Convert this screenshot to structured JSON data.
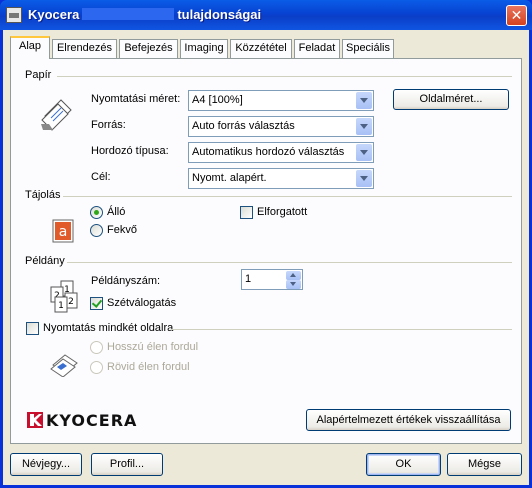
{
  "window": {
    "title_prefix": "Kyocera",
    "title_suffix": "tulajdonságai",
    "close_glyph": "✕"
  },
  "tabs": [
    {
      "label": "Alap",
      "active": true
    },
    {
      "label": "Elrendezés"
    },
    {
      "label": "Befejezés"
    },
    {
      "label": "Imaging"
    },
    {
      "label": "Közzététel"
    },
    {
      "label": "Feladat"
    },
    {
      "label": "Speciális"
    }
  ],
  "paper": {
    "group_label": "Papír",
    "print_size_label": "Nyomtatási méret:",
    "print_size_value": "A4  [100%]",
    "page_size_button": "Oldalméret...",
    "source_label": "Forrás:",
    "source_value": "Auto forrás választás",
    "media_type_label": "Hordozó típusa:",
    "media_type_value": "Automatikus hordozó választás",
    "destination_label": "Cél:",
    "destination_value": "Nyomt. alapért."
  },
  "orientation": {
    "group_label": "Tájolás",
    "portrait_label": "Álló",
    "portrait_selected": true,
    "landscape_label": "Fekvő",
    "rotated_label": "Elforgatott",
    "rotated_checked": false
  },
  "copies": {
    "group_label": "Példány",
    "copies_label": "Példányszám:",
    "copies_value": "1",
    "collate_label": "Szétválogatás",
    "collate_checked": true
  },
  "duplex": {
    "checkbox_label": "Nyomtatás mindkét oldalra",
    "checked": false,
    "long_edge_label": "Hosszú élen fordul",
    "short_edge_label": "Rövid élen fordul"
  },
  "brand": {
    "logo_text": "KYOCERA",
    "logo_color": "#c8102e"
  },
  "restore_defaults_button": "Alapértelmezett értékek visszaállítása",
  "footer": {
    "profile_name_button": "Névjegy...",
    "profile_button": "Profil...",
    "ok_button": "OK",
    "cancel_button": "Mégse"
  }
}
